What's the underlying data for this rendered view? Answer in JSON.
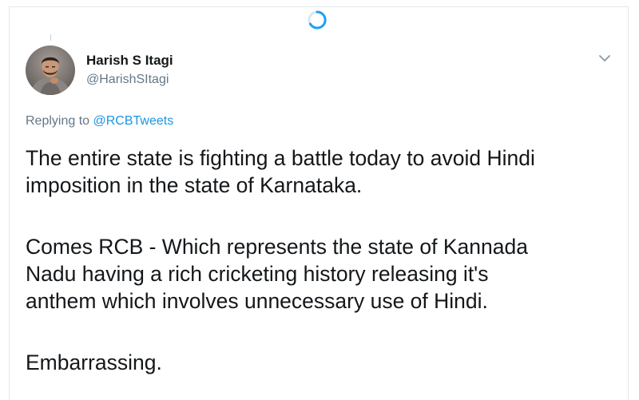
{
  "tweet": {
    "author": {
      "display_name": "Harish S Itagi",
      "handle": "@HarishSItagi"
    },
    "replying_to": {
      "prefix": "Replying to",
      "mention": "@RCBTweets"
    },
    "paragraphs": [
      {
        "lines": [
          "The entire state is fighting a battle today to avoid Hindi",
          "imposition in the state of Karnataka."
        ]
      },
      {
        "lines": [
          "Comes RCB - Which represents the state of Kannada",
          "Nadu having a rich cricketing history releasing it's",
          "anthem which involves unnecessary use of Hindi."
        ]
      },
      {
        "lines": [
          "Embarrassing."
        ]
      }
    ]
  },
  "icons": {
    "loading": "loading-spinner-icon",
    "caret": "chevron-down-icon"
  },
  "colors": {
    "accent": "#1b95e0",
    "text_primary": "#14171a",
    "text_secondary": "#657786",
    "border": "#e1e8ed"
  }
}
